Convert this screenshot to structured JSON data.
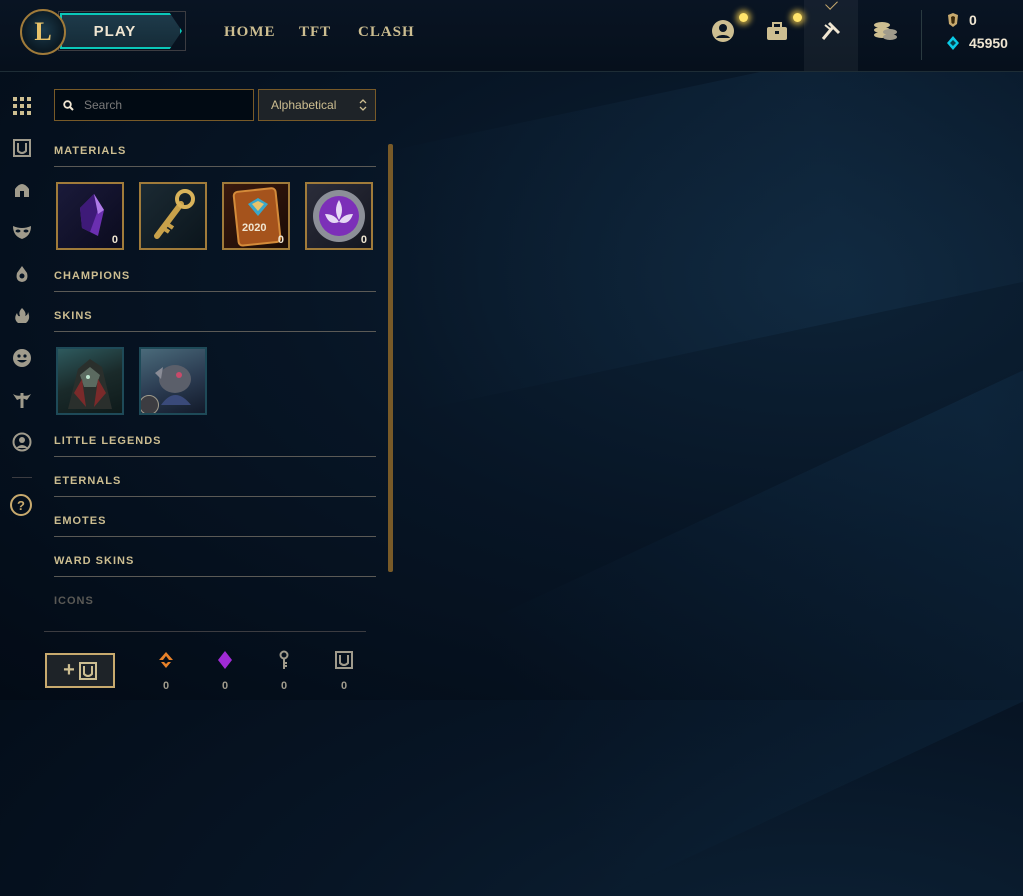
{
  "topbar": {
    "play_label": "PLAY",
    "nav": [
      "HOME",
      "TFT",
      "CLASH"
    ],
    "icons": [
      "profile-icon",
      "collection-icon",
      "loot-icon",
      "store-icon"
    ],
    "riot_points": "0",
    "blue_essence": "45950"
  },
  "rail": {
    "icons": [
      "all-grid-icon",
      "chest-icon",
      "champion-helm-icon",
      "mask-icon",
      "flask-icon",
      "fire-icon",
      "emote-icon",
      "ward-icon",
      "icons-profile-icon"
    ],
    "help": "?"
  },
  "search": {
    "placeholder": "Search",
    "sort_selected": "Alphabetical"
  },
  "categories": {
    "materials": "MATERIALS",
    "champions": "CHAMPIONS",
    "skins": "SKINS",
    "little_legends": "LITTLE LEGENDS",
    "eternals": "ETERNALS",
    "emotes": "EMOTES",
    "ward_skins": "WARD SKINS",
    "icons": "ICONS"
  },
  "materials": [
    {
      "name": "key-fragment-gem",
      "count": "0"
    },
    {
      "name": "hextech-key",
      "count": "0"
    },
    {
      "name": "mastery-token-2020",
      "count": "0",
      "label": "2020"
    },
    {
      "name": "orb",
      "count": "0"
    }
  ],
  "skins": [
    {
      "name": "skin-1"
    },
    {
      "name": "skin-2"
    }
  ],
  "bottom": {
    "add_label": "+",
    "wallet": [
      {
        "icon": "orange-essence-icon",
        "value": "0",
        "color": "#e8822a"
      },
      {
        "icon": "mythic-essence-icon",
        "value": "0",
        "color": "#a12bd6"
      },
      {
        "icon": "key-icon",
        "value": "0",
        "color": "#a09b8c"
      },
      {
        "icon": "chest-icon",
        "value": "0",
        "color": "#a09b8c"
      }
    ]
  },
  "colors": {
    "gold": "#c8aa6e",
    "teal": "#0ac8b9",
    "text": "#cdbe91",
    "bg": "#010a13"
  }
}
